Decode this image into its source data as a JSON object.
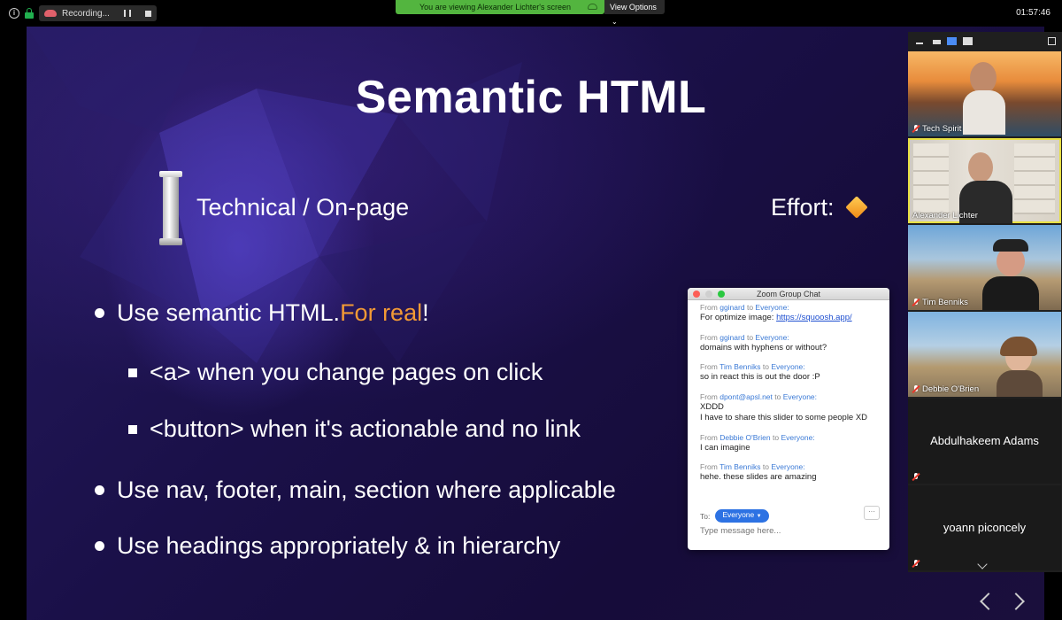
{
  "topbar": {
    "recording_label": "Recording...",
    "share_banner": "You are viewing Alexander Lichter's screen",
    "view_options": "View Options",
    "clock": "01:57:46"
  },
  "slide": {
    "title": "Semantic HTML",
    "subtitle": "Technical / On-page",
    "effort_label": "Effort:",
    "bullets": [
      {
        "text": "Use semantic HTML. ",
        "accent": "For real",
        "suffix": "!"
      },
      {
        "text": "<a> when you change pages on click"
      },
      {
        "text": "<button> when it's actionable and no link"
      },
      {
        "text": "Use nav, footer, main, section where applicable"
      },
      {
        "text": "Use headings appropriately & in hierarchy"
      }
    ]
  },
  "chat": {
    "title": "Zoom Group Chat",
    "from_word": "From",
    "to_word": "to",
    "messages": [
      {
        "sender": "gginard",
        "recipient": "Everyone:",
        "lines": [
          "For optimize image: "
        ],
        "link": "https://squoosh.app/"
      },
      {
        "sender": "gginard",
        "recipient": "Everyone:",
        "lines": [
          "domains with hyphens or without?"
        ]
      },
      {
        "sender": "Tim Benniks",
        "recipient": "Everyone:",
        "lines": [
          "so in react this is out the door :P"
        ]
      },
      {
        "sender": "dpont@apsl.net",
        "recipient": "Everyone:",
        "lines": [
          "XDDD",
          "I have to share this slider to some people XD"
        ]
      },
      {
        "sender": "Debbie O'Brien",
        "recipient": "Everyone:",
        "lines": [
          "I can imagine"
        ]
      },
      {
        "sender": "Tim Benniks",
        "recipient": "Everyone:",
        "lines": [
          "hehe. these slides are amazing"
        ]
      }
    ],
    "to_label": "To:",
    "recipient_select": "Everyone",
    "more_label": "···",
    "input_placeholder": "Type message here..."
  },
  "participants": [
    {
      "name": "Tech Spirit",
      "video": true,
      "muted": true
    },
    {
      "name": "Alexander Lichter",
      "video": true,
      "muted": false,
      "active": true
    },
    {
      "name": "Tim Benniks",
      "video": true,
      "muted": true
    },
    {
      "name": "Debbie O'Brien",
      "video": true,
      "muted": true
    },
    {
      "name": "Abdulhakeem Adams",
      "video": false,
      "muted": true
    },
    {
      "name": "yoann piconcely",
      "video": false,
      "muted": true
    }
  ],
  "colors": {
    "share_banner": "#53b53f",
    "accent_orange": "#f29a35",
    "chat_link_blue": "#3b7ad6",
    "active_speaker": "#e8e043"
  }
}
